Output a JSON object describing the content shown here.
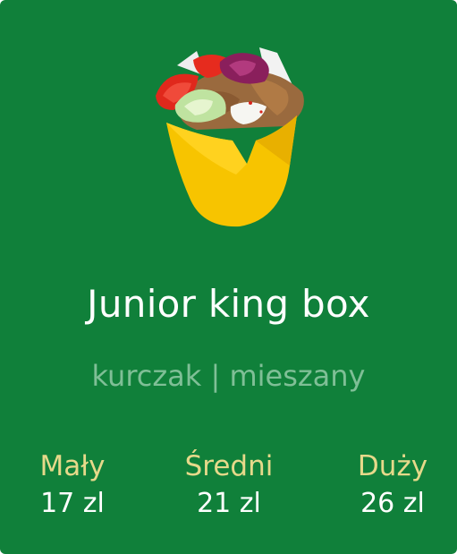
{
  "colors": {
    "background": "#10803a",
    "title": "#ffffff",
    "subtitle": "#7fbf96",
    "size_label": "#e6d98a",
    "price": "#ffffff"
  },
  "product": {
    "image_icon": "kebab-box-icon",
    "name": "Junior king box",
    "variants": "kurczak | mieszany",
    "sizes": [
      {
        "label": "Mały",
        "price": "17 zl"
      },
      {
        "label": "Średni",
        "price": "21 zl"
      },
      {
        "label": "Duży",
        "price": "26 zl"
      }
    ]
  }
}
